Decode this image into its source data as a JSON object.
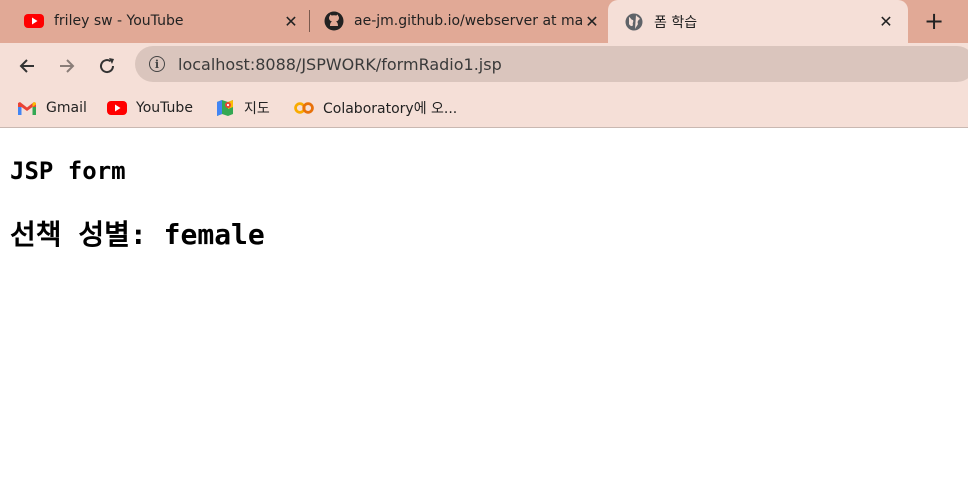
{
  "tabs": [
    {
      "title": "friley sw - YouTube",
      "icon": "youtube-icon"
    },
    {
      "title": "ae-jm.github.io/webserver at ma",
      "icon": "github-icon"
    },
    {
      "title": "폼 학습",
      "icon": "globe-icon",
      "active": true
    }
  ],
  "toolbar": {
    "url": "localhost:8088/JSPWORK/formRadio1.jsp"
  },
  "bookmarks": [
    {
      "label": "Gmail",
      "icon": "gmail-icon"
    },
    {
      "label": "YouTube",
      "icon": "youtube-icon"
    },
    {
      "label": "지도",
      "icon": "maps-icon"
    },
    {
      "label": "Colaboratory에 오...",
      "icon": "colab-icon"
    }
  ],
  "page": {
    "heading": "JSP form",
    "result_label": "선책 성별:",
    "result_value": "female"
  },
  "colors": {
    "tabstrip_bg": "#e1a996",
    "toolbar_bg": "#f5dfd7",
    "omnibox_bg": "#dac5bd",
    "youtube_red": "#ff0000"
  }
}
